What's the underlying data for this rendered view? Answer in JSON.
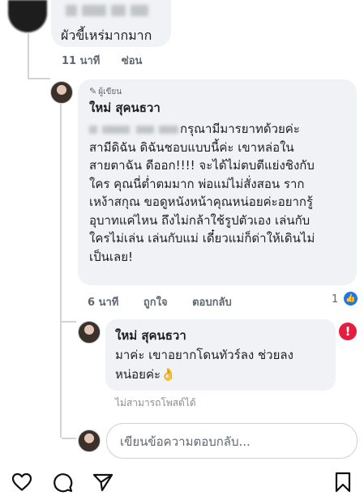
{
  "top_comment": {
    "text": "ผัวขี้เหร่มากมาก",
    "time": "11 นาที",
    "action": "ซ่อน"
  },
  "main_reply": {
    "author_tag": "ผู้เขียน",
    "author_name": "ใหม่ สุคนธวา",
    "lines": [
      "กรุณามีมารยาทด้วยค่ะ",
      "สามีดิฉัน ดิฉันชอบแบบนี้ค่ะ เขาหล่อใน",
      "สายตาฉัน ดีออก!!!! จะได้ไม่ตบตีแย่งชิงกับ",
      "ใคร คุณนี่ต่ำตมมาก พ่อแม่ไม่สั่งสอน ราก",
      "เหง้าสกุณ ขอดูหนังหน้าคุณหน่อยค่ะอยากรู้",
      "อุบาทแค่ไหน ถึงไม่กล้าใช้รูปตัวเอง เล่นกับ",
      "ใครไม่เล่น เล่นกับแม่ เดี๋ยวแม่ก็ด่าให้เดินไม่",
      "เป็นเลย!"
    ],
    "time": "6 นาที",
    "like": "ถูกใจ",
    "reply": "ตอบกลับ",
    "like_count": "1"
  },
  "nested_reply": {
    "author_name": "ใหม่ สุคนธวา",
    "line1": "มาค่ะ เขาอยากโดนทัวร์ลง ช่วยลง",
    "line2": "หน่อยค่ะ👌",
    "status": "ไม่สามารถโพสต์ได้"
  },
  "reply_input": {
    "placeholder": "เขียนข้อความตอบกลับ..."
  },
  "icons": [
    "heart-icon",
    "comment-icon",
    "share-icon",
    "bookmark-icon",
    "thumbs-up-icon",
    "error-icon",
    "pencil-icon"
  ],
  "colors": {
    "like_blue": "#1877f2",
    "error_red": "#e41e3f",
    "bubble_bg": "#f0f2f5"
  }
}
